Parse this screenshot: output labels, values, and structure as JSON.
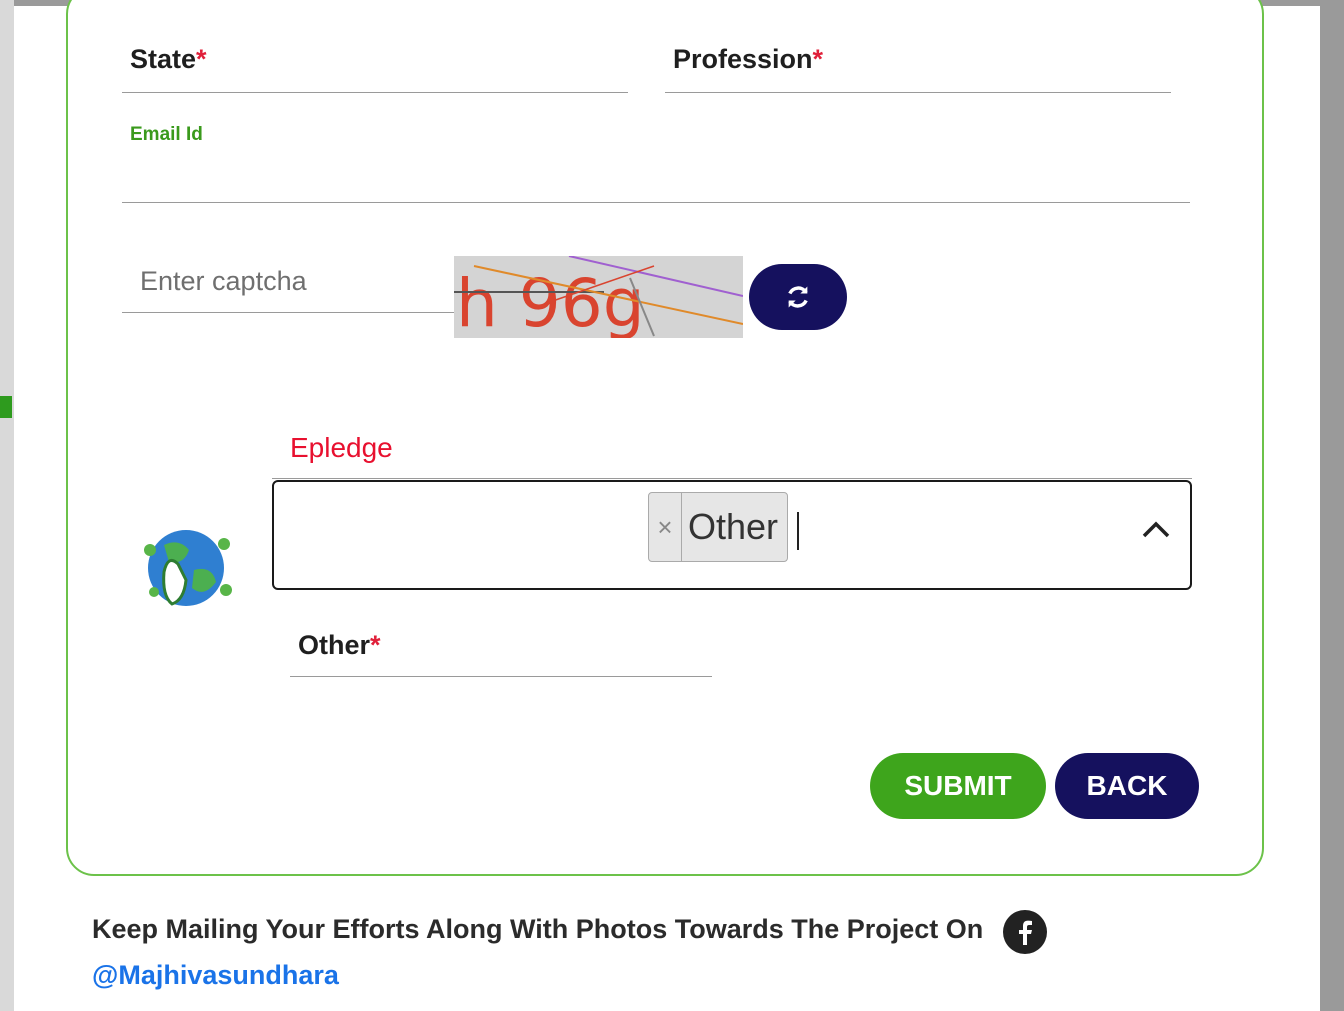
{
  "form": {
    "state_label": "State",
    "profession_label": "Profession",
    "required_mark": "*",
    "email_label": "Email Id",
    "captcha_placeholder": "Enter captcha",
    "captcha_text": "h 96g",
    "epledge_label": "Epledge",
    "epledge_selected": "Other",
    "chip_remove": "×",
    "other_label": "Other"
  },
  "buttons": {
    "submit": "SUBMIT",
    "back": "BACK"
  },
  "footer": {
    "message": "Keep Mailing Your Efforts Along With Photos Towards The Project On",
    "handle": "@Majhivasundhara"
  },
  "colors": {
    "accent_green": "#3ea51c",
    "navy": "#15115e",
    "required_red": "#e0203a",
    "link_blue": "#1a73e8"
  },
  "icons": [
    "refresh-icon",
    "chevron-up-icon",
    "facebook-icon",
    "earth-pledge-icon"
  ]
}
